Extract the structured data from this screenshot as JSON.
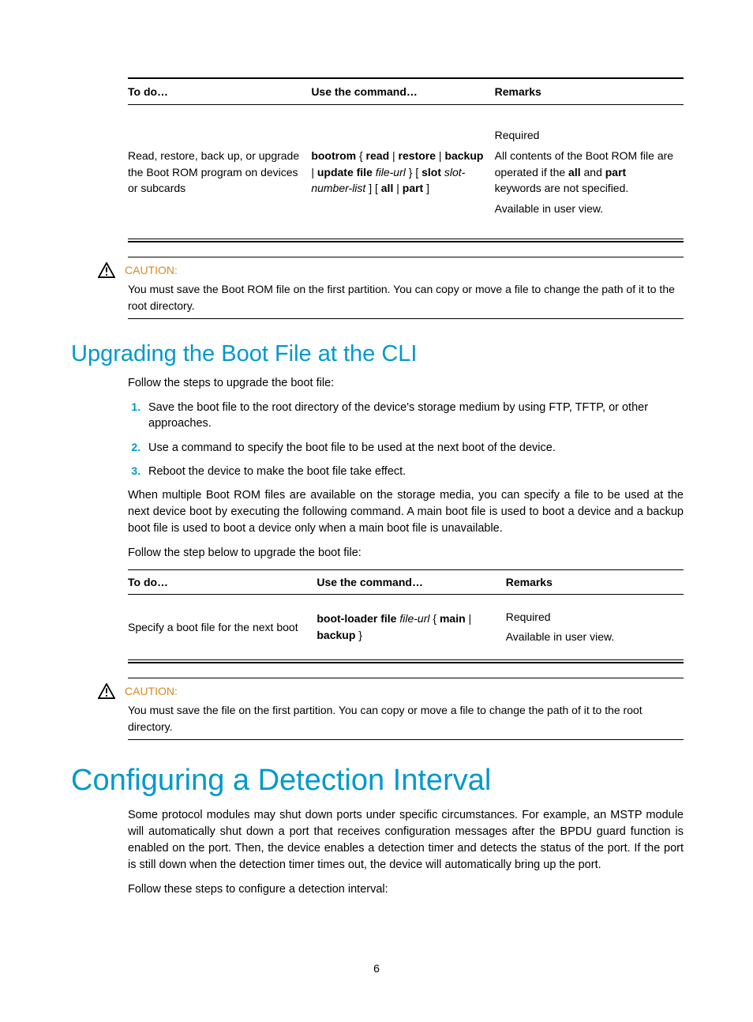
{
  "table1": {
    "headers": {
      "todo": "To do…",
      "cmd": "Use the command…",
      "remarks": "Remarks"
    },
    "row": {
      "todo": "Read, restore, back up, or upgrade the Boot ROM program on devices or subcards",
      "cmd_parts": {
        "p1": "bootrom",
        "p2": " { ",
        "p3": "read",
        "p4": " | ",
        "p5": "restore",
        "p6": " | ",
        "p7": "backup",
        "p8": " | ",
        "p9": "update file",
        "p10": " ",
        "p11": "file-url",
        "p12": " } [ ",
        "p13": "slot",
        "p14": " ",
        "p15": "slot-number-list",
        "p16": " ] [ ",
        "p17": "all",
        "p18": " | ",
        "p19": "part",
        "p20": " ]"
      },
      "remarks": {
        "r1": "Required",
        "r2a": "All contents of the Boot ROM file are operated if the ",
        "r2b": "all",
        "r2c": " and ",
        "r2d": "part",
        "r2e": " keywords are not specified.",
        "r3": "Available in user view."
      }
    }
  },
  "caution1": {
    "label": "CAUTION:",
    "text": "You must save the Boot ROM file on the first partition. You can copy or move a file to change the path of it to the root directory."
  },
  "section1": {
    "title": "Upgrading the Boot File at the CLI",
    "intro": "Follow the steps to upgrade the boot file:",
    "steps": {
      "s1": "Save the boot file to the root directory of the device's storage medium by using FTP, TFTP, or other approaches.",
      "s2": "Use a command to specify the boot file to be used at the next boot of the device.",
      "s3": "Reboot the device to make the boot file take effect."
    },
    "para2": "When multiple Boot ROM files are available on the storage media, you can specify a file to be used at the next device boot by executing the following command. A main boot file is used to boot a device and a backup boot file is used to boot a device only when a main boot file is unavailable.",
    "para3": "Follow the step below to upgrade the boot file:"
  },
  "table2": {
    "headers": {
      "todo": "To do…",
      "cmd": "Use the command…",
      "remarks": "Remarks"
    },
    "row": {
      "todo": "Specify a boot file for the next boot",
      "cmd": {
        "c1": "boot-loader file",
        "c2": " ",
        "c3": "file-url",
        "c4": " { ",
        "c5": "main",
        "c6": " | ",
        "c7": "backup",
        "c8": " }"
      },
      "remarks": {
        "r1": "Required",
        "r2": "Available in user view."
      }
    }
  },
  "caution2": {
    "label": "CAUTION:",
    "text": "You must save the file on the first partition. You can copy or move a file to change the path of it to the root directory."
  },
  "section2": {
    "title": "Configuring a Detection Interval",
    "para1": "Some protocol modules may shut down ports under specific circumstances. For example, an MSTP module will automatically shut down a port that receives configuration messages after the BPDU guard function is enabled on the port. Then, the device enables a detection timer and detects the status of the port. If the port is still down when the detection timer times out, the device will automatically bring up the port.",
    "para2": "Follow these steps to configure a detection interval:"
  },
  "pageNumber": "6"
}
